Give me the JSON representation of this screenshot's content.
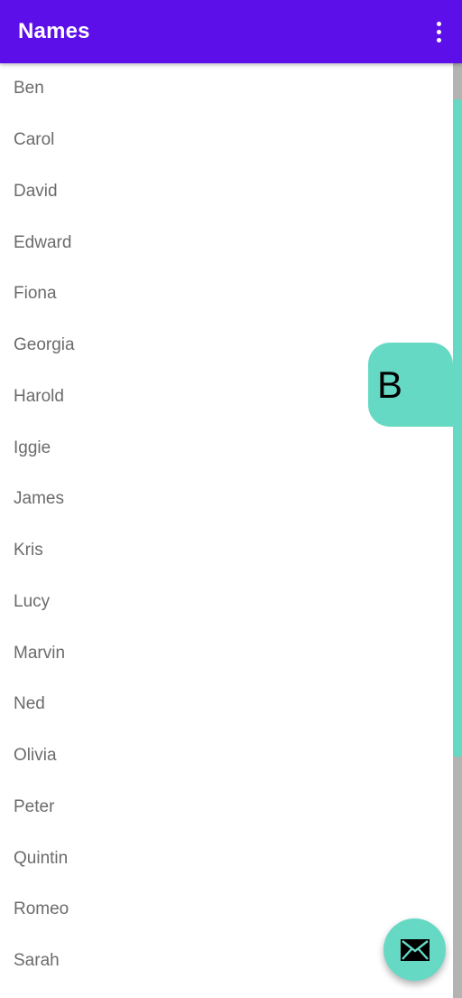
{
  "appbar": {
    "title": "Names",
    "overflow_icon": "more-vert-icon",
    "background": "#5c0fe8"
  },
  "list": {
    "items": [
      "Ben",
      "Carol",
      "David",
      "Edward",
      "Fiona",
      "Georgia",
      "Harold",
      "Iggie",
      "James",
      "Kris",
      "Lucy",
      "Marvin",
      "Ned",
      "Olivia",
      "Peter",
      "Quintin",
      "Romeo",
      "Sarah"
    ]
  },
  "fast_scroller": {
    "bubble_letter": "B",
    "accent": "#66d9c5",
    "track_color": "#b3b3b3"
  },
  "fab": {
    "icon": "email-icon",
    "color": "#66d9c5"
  }
}
